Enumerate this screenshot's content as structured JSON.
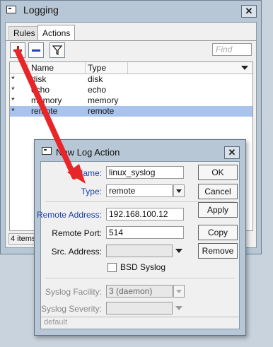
{
  "window": {
    "title": "Logging",
    "close_glyph": "✕"
  },
  "tabs": [
    {
      "label": "Rules"
    },
    {
      "label": "Actions"
    }
  ],
  "toolbar": {
    "find_placeholder": "Find"
  },
  "table": {
    "columns": [
      "Name",
      "Type"
    ],
    "rows": [
      {
        "flag": "*",
        "name": "disk",
        "type": "disk"
      },
      {
        "flag": "*",
        "name": "echo",
        "type": "echo"
      },
      {
        "flag": "*",
        "name": "memory",
        "type": "memory"
      },
      {
        "flag": "*",
        "name": "remote",
        "type": "remote",
        "selected": true
      }
    ]
  },
  "status": {
    "count": "4 items"
  },
  "dialog": {
    "title": "New Log Action",
    "close_glyph": "✕",
    "name_label": "Name:",
    "name_value": "linux_syslog",
    "type_label": "Type:",
    "type_value": "remote",
    "remote_address_label": "Remote Address:",
    "remote_address_value": "192.168.100.12",
    "remote_port_label": "Remote Port:",
    "remote_port_value": "514",
    "src_address_label": "Src. Address:",
    "src_address_value": "",
    "bsd_syslog_label": "BSD Syslog",
    "syslog_facility_label": "Syslog Facility:",
    "syslog_facility_value": "3 (daemon)",
    "syslog_severity_label": "Syslog Severity:",
    "syslog_severity_value": "",
    "buttons": {
      "ok": "OK",
      "cancel": "Cancel",
      "apply": "Apply",
      "copy": "Copy",
      "remove": "Remove"
    },
    "status": "default"
  },
  "colors": {
    "annotation_arrow": "#e8262a",
    "selection": "#a9c4ec",
    "label_blue": "#1c3ea8"
  }
}
